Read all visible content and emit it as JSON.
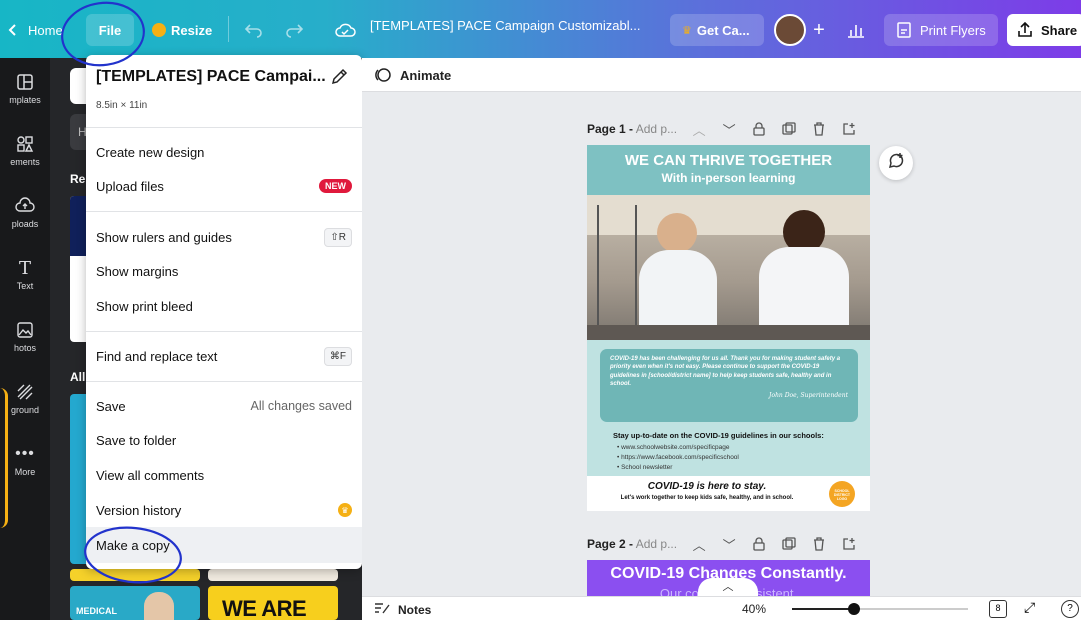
{
  "topbar": {
    "home": "Home",
    "file": "File",
    "resize": "Resize",
    "doc_title": "[TEMPLATES] PACE Campaign Customizabl...",
    "get_canva": "Get Ca...",
    "print_flyers": "Print Flyers",
    "share": "Share"
  },
  "sidebar": {
    "items": [
      {
        "label": "mplates",
        "icon": "templates-icon"
      },
      {
        "label": "ements",
        "icon": "elements-icon"
      },
      {
        "label": "ploads",
        "icon": "uploads-icon"
      },
      {
        "label": "Text",
        "icon": "text-icon"
      },
      {
        "label": "hotos",
        "icon": "photos-icon"
      },
      {
        "label": "ground",
        "icon": "background-icon"
      },
      {
        "label": "More",
        "icon": "more-icon"
      }
    ]
  },
  "panel": {
    "search_placeholder": "H",
    "recent_label": "Re",
    "all_label": "All",
    "thumb_text_1": "WE ARE",
    "thumb_text_2": "MEDICAL"
  },
  "file_menu": {
    "title": "[TEMPLATES] PACE Campai...",
    "size": "8.5in × 11in",
    "items": {
      "create_new_design": "Create new design",
      "upload_files": "Upload files",
      "upload_badge": "NEW",
      "show_rulers": "Show rulers and guides",
      "show_rulers_shortcut": "⇧R",
      "show_margins": "Show margins",
      "show_print_bleed": "Show print bleed",
      "find_replace": "Find and replace text",
      "find_replace_shortcut": "⌘F",
      "save": "Save",
      "save_status": "All changes saved",
      "save_to_folder": "Save to folder",
      "view_all_comments": "View all comments",
      "version_history": "Version history",
      "make_a_copy": "Make a copy"
    }
  },
  "canvas": {
    "animate": "Animate",
    "page1_label": "Page 1 -",
    "page1_add": "Add p...",
    "page2_label": "Page 2 -",
    "page2_add": "Add p...",
    "flyer": {
      "headline": "WE CAN THRIVE TOGETHER",
      "subhead": "With in-person learning",
      "message": "COVID-19 has been challenging for us all. Thank you for making student safety a priority even when it's not easy. Please continue to support the COVID-19 guidelines in [school/district name] to help keep students safe, healthy and in school.",
      "signature": "John Doe, Superintendent",
      "stay_title": "Stay up-to-date on the COVID-19 guidelines in our schools:",
      "links": [
        "www.schoolwebsite.com/specificpage",
        "https://www.facebook.com/specificschool",
        "School newsletter"
      ],
      "footer_title": "COVID-19 is here to stay.",
      "footer_sub": "Let's work together to keep kids safe, healthy, and in school.",
      "logo_text": "SCHOOL DISTRICT LOGO"
    },
    "page2_headline": "COVID-19 Changes Constantly.",
    "page2_sub": "Our comm... consistent."
  },
  "bottom": {
    "notes": "Notes",
    "zoom": "40%",
    "page_count": "8"
  },
  "colors": {
    "accent": "#7d3ce8",
    "teal": "#7ec1c2",
    "annotation": "#2233cc",
    "badge_red": "#e0193c"
  }
}
